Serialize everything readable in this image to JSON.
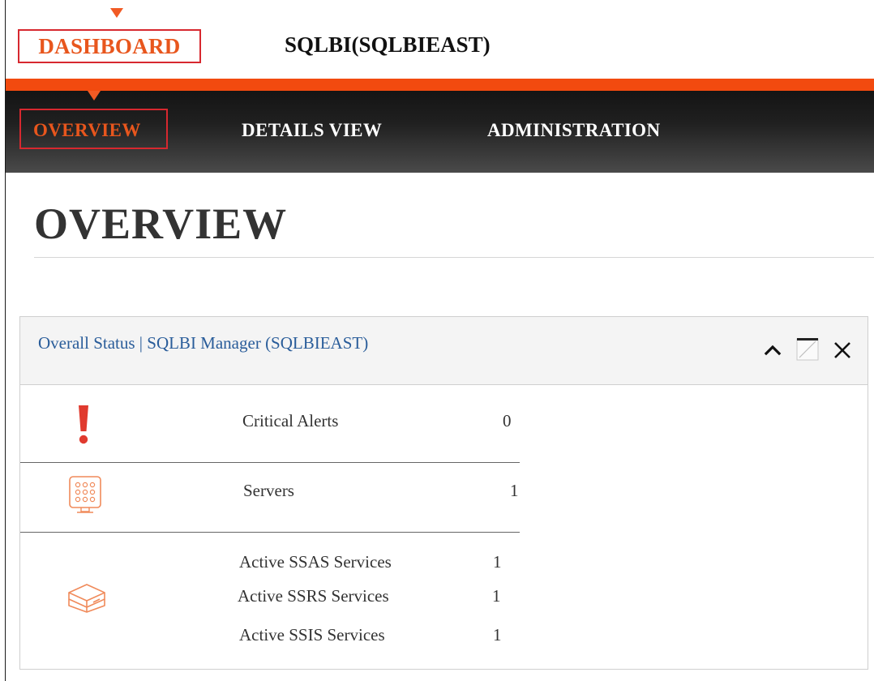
{
  "header": {
    "brand": "DASHBOARD",
    "server": "SQLBI(SQLBIEAST)"
  },
  "nav": {
    "items": [
      {
        "label": "OVERVIEW",
        "active": true
      },
      {
        "label": "DETAILS VIEW",
        "active": false
      },
      {
        "label": "ADMINISTRATION",
        "active": false
      }
    ]
  },
  "page": {
    "title": "OVERVIEW"
  },
  "widget": {
    "title": "Overall Status | SQLBI Manager (SQLBIEAST)",
    "controls": [
      "collapse-icon",
      "maximize-icon",
      "close-icon"
    ],
    "critical": {
      "label": "Critical Alerts",
      "value": "0",
      "icon": "alert-icon"
    },
    "servers": {
      "label": "Servers",
      "value": "1",
      "icon": "server-icon"
    },
    "services": {
      "icon": "services-icon",
      "ssas": {
        "label": "Active SSAS Services",
        "value": "1"
      },
      "ssrs": {
        "label": "Active SSRS Services",
        "value": "1"
      },
      "ssis": {
        "label": "Active SSIS Services",
        "value": "1"
      }
    }
  },
  "colors": {
    "accent": "#f24a0f",
    "brand_text": "#e8561d",
    "highlight_box": "#d7282f",
    "link": "#2a5d9a",
    "alert": "#e03a2e"
  }
}
